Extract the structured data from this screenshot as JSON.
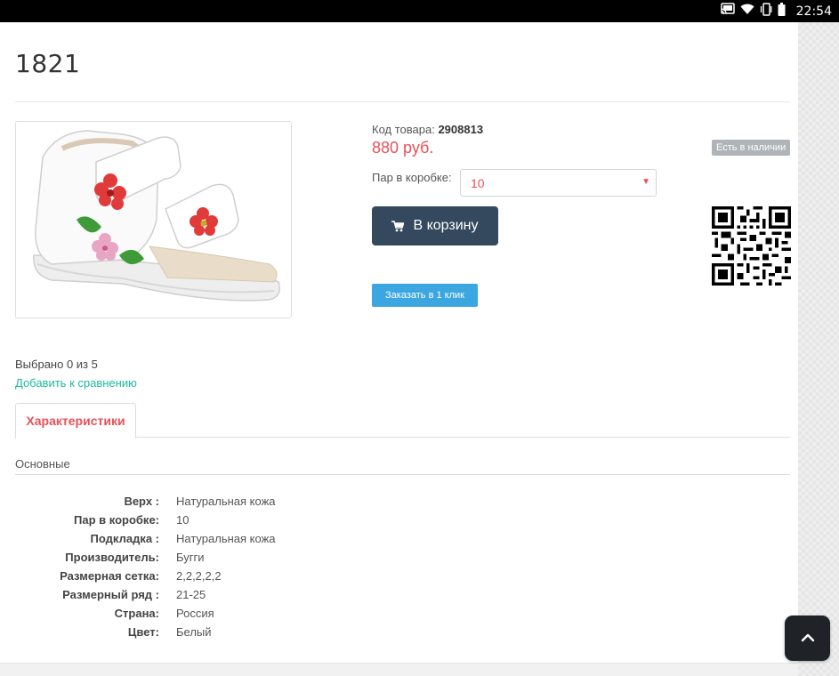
{
  "status_bar": {
    "time": "22:54",
    "icons": [
      "cast-icon",
      "wifi-icon",
      "phone-vibrate-icon",
      "battery-icon"
    ]
  },
  "product": {
    "title": "1821",
    "code_label": "Код товара:",
    "code_value": "2908813",
    "price": "880 руб.",
    "stock_badge": "Есть в наличии",
    "qty_label": "Пар в коробке:",
    "qty_selected": "10",
    "cart_button": "В корзину",
    "oneclick_button": "Заказать в 1 клик"
  },
  "compare": {
    "selected_text": "Выбрано 0 из 5",
    "add_link": "Добавить к сравнению"
  },
  "tabs": [
    {
      "label": "Характеристики",
      "active": true
    }
  ],
  "specs": {
    "section_title": "Основные",
    "rows": [
      {
        "label": "Верх :",
        "value": "Натуральная кожа"
      },
      {
        "label": "Пар в коробке:",
        "value": "10"
      },
      {
        "label": "Подкладка :",
        "value": "Натуральная кожа"
      },
      {
        "label": "Производитель:",
        "value": "Бугги"
      },
      {
        "label": "Размерная сетка:",
        "value": "2,2,2,2,2"
      },
      {
        "label": "Размерный ряд :",
        "value": "21-25"
      },
      {
        "label": "Страна:",
        "value": "Россия"
      },
      {
        "label": "Цвет:",
        "value": "Белый"
      }
    ]
  },
  "colors": {
    "price": "#e8515a",
    "cart_button": "#34495e",
    "oneclick_button": "#3ba6e0",
    "compare_link": "#1abc9c",
    "stock_badge": "#b0b4b8"
  }
}
